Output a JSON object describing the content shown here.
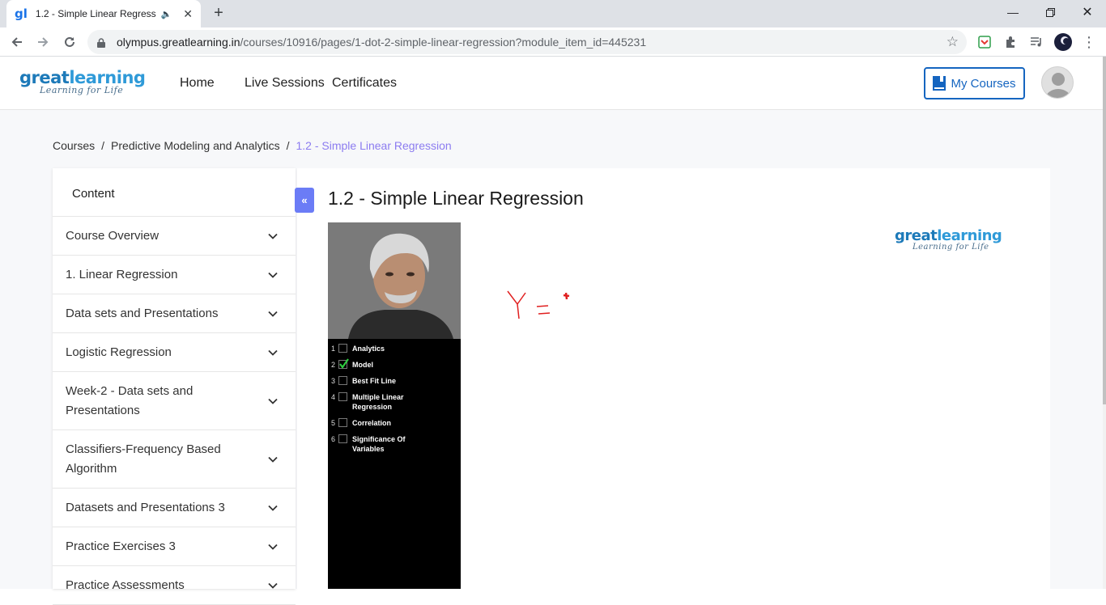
{
  "browser": {
    "tab_title": "1.2 - Simple Linear Regressic",
    "favicon_text": "gl",
    "url_host": "olympus.greatlearning.in",
    "url_path": "/courses/10916/pages/1-dot-2-simple-linear-regression?module_item_id=445231"
  },
  "header": {
    "logo_word_1": "great",
    "logo_word_2": "learning",
    "logo_tagline": "Learning for Life",
    "nav": [
      "Home",
      "Live Sessions",
      "Certificates"
    ],
    "my_courses": "My Courses"
  },
  "breadcrumb": {
    "items": [
      "Courses",
      "Predictive Modeling and Analytics"
    ],
    "separator": "/",
    "current": "1.2 - Simple Linear Regression"
  },
  "sidebar": {
    "heading": "Content",
    "items": [
      "Course Overview",
      "1. Linear Regression",
      "Data sets and Presentations",
      "Logistic Regression",
      "Week-2 - Data sets and Presentations",
      "Classifiers-Frequency Based Algorithm",
      "Datasets and Presentations 3",
      "Practice Exercises 3",
      "Practice Assessments"
    ]
  },
  "main": {
    "title": "1.2 - Simple Linear Regression",
    "collapse_icon": "«",
    "video_checklist": [
      {
        "num": "1",
        "label": "Analytics",
        "checked": false
      },
      {
        "num": "2",
        "label": "Model",
        "checked": true
      },
      {
        "num": "3",
        "label": "Best Fit Line",
        "checked": false
      },
      {
        "num": "4",
        "label": "Multiple Linear Regression",
        "checked": false
      },
      {
        "num": "5",
        "label": "Correlation",
        "checked": false
      },
      {
        "num": "6",
        "label": "Significance Of Variables",
        "checked": false
      }
    ],
    "board_logo_word_1": "great",
    "board_logo_word_2": "learning",
    "board_logo_tagline": "Learning for Life"
  },
  "colors": {
    "brand_blue": "#1565c0",
    "breadcrumb_current": "#8c7cf0",
    "collapse_button": "#6b7cf6",
    "check_green": "#2ecc40",
    "handwriting_red": "#e02020"
  }
}
